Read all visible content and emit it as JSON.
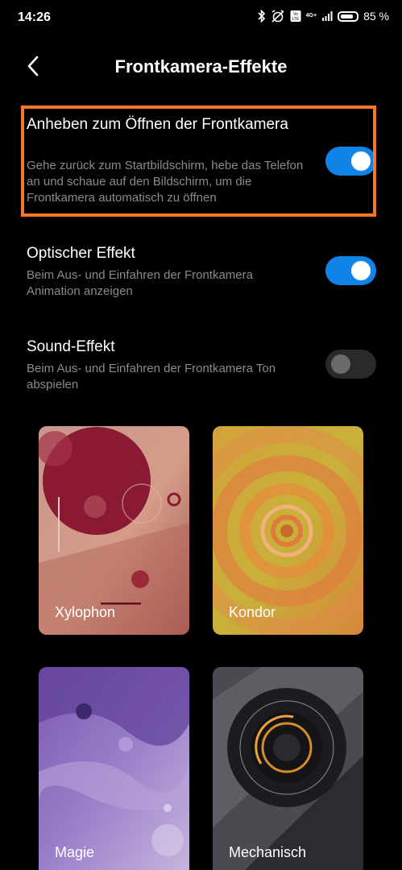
{
  "status": {
    "time": "14:26",
    "network_top": "4G+",
    "network_side": "Vo LTE",
    "battery_text": "85 %",
    "battery_level": 0.85,
    "icons": [
      "bluetooth-icon",
      "alarm-off-icon",
      "volte-icon",
      "signal-icon",
      "battery-icon"
    ]
  },
  "header": {
    "back_icon": "back-arrow-icon",
    "title": "Frontkamera-Effekte"
  },
  "settings": [
    {
      "title": "Anheben zum Öffnen der Frontkamera",
      "description": "Gehe zurück zum Startbildschirm, hebe das Telefon an und schaue auf den Bildschirm, um die Frontkamera automatisch zu öffnen",
      "enabled": true
    },
    {
      "title": "Optischer Effekt",
      "description": "Beim Aus- und Einfahren der Frontkamera Animation anzeigen",
      "enabled": true
    },
    {
      "title": "Sound-Effekt",
      "description": "Beim Aus- und Einfahren der Frontkamera Ton abspielen",
      "enabled": false
    }
  ],
  "effects": [
    {
      "label": "Xylophon"
    },
    {
      "label": "Kondor"
    },
    {
      "label": "Magie"
    },
    {
      "label": "Mechanisch"
    }
  ],
  "colors": {
    "accent": "#0d84e6",
    "highlight_border": "#f4772a",
    "background": "#000000",
    "secondary_text": "#8a8a8a"
  }
}
